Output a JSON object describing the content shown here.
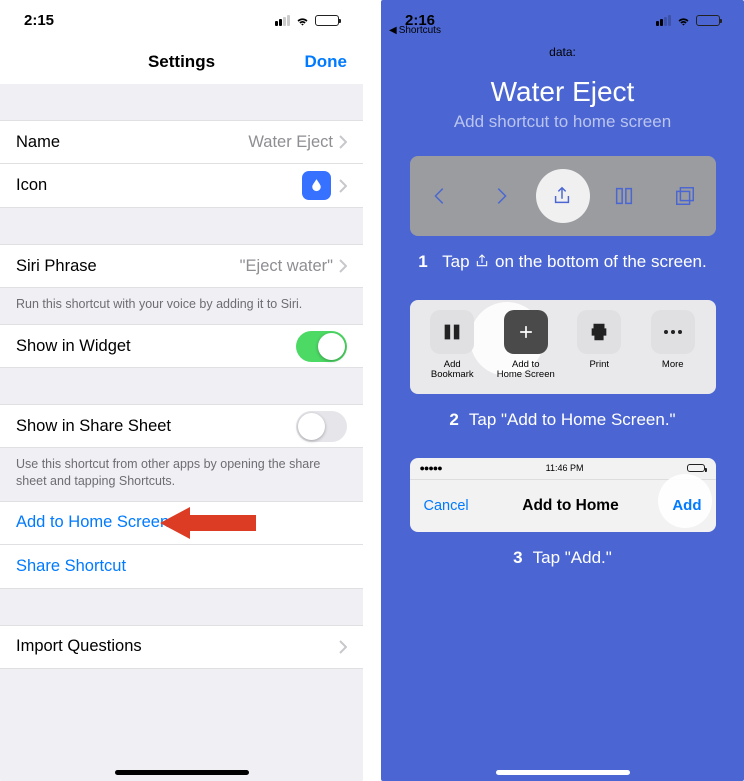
{
  "left": {
    "status_time": "2:15",
    "nav_title": "Settings",
    "nav_done": "Done",
    "name_label": "Name",
    "name_value": "Water Eject",
    "icon_label": "Icon",
    "siri_label": "Siri Phrase",
    "siri_value": "\"Eject water\"",
    "siri_footer": "Run this shortcut with your voice by adding it to Siri.",
    "widget_label": "Show in Widget",
    "share_sheet_label": "Show in Share Sheet",
    "share_sheet_footer": "Use this shortcut from other apps by opening the share sheet and tapping Shortcuts.",
    "add_home_label": "Add to Home Screen",
    "share_shortcut_label": "Share Shortcut",
    "import_label": "Import Questions"
  },
  "right": {
    "status_time": "2:16",
    "back_app": "Shortcuts",
    "url_hint": "data:",
    "title": "Water Eject",
    "subtitle": "Add shortcut to home screen",
    "step1_prefix": "1",
    "step1_part1": "Tap",
    "step1_part2": "on the bottom of the screen.",
    "share_items": {
      "bookmark": "Add\nBookmark",
      "home": "Add to\nHome Screen",
      "print": "Print",
      "more": "More"
    },
    "step2_num": "2",
    "step2_text": "Tap \"Add to Home Screen.\"",
    "addbar": {
      "time": "11:46 PM",
      "cancel": "Cancel",
      "title": "Add to Home",
      "add": "Add"
    },
    "step3_num": "3",
    "step3_text": "Tap \"Add.\""
  }
}
